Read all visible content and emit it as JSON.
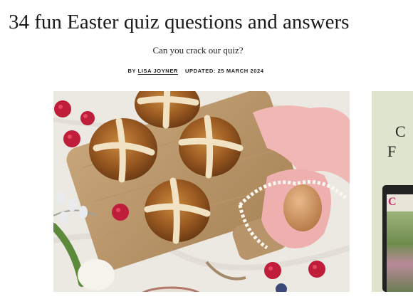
{
  "article": {
    "title": "34 fun Easter quiz questions and answers",
    "subtitle": "Can you crack our quiz?",
    "byline": {
      "by_label": "BY",
      "author": "LISA JOYNER",
      "updated_label": "UPDATED:",
      "updated_date": "25 MARCH 2024"
    }
  },
  "hero_image": {
    "subject": "hot-cross-buns-on-wooden-board"
  },
  "advert": {
    "letters": [
      "C",
      "F"
    ],
    "magazine_logo": "C"
  },
  "colors": {
    "text": "#1a1a1a",
    "advert_bg": "#dfe4cf",
    "magazine_logo": "#c0306e"
  }
}
